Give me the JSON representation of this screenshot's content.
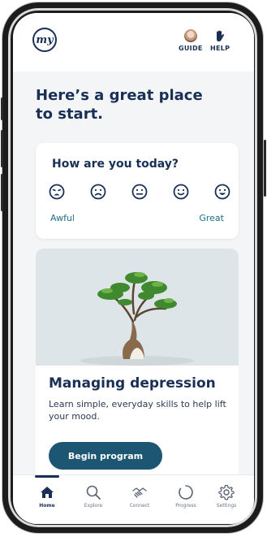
{
  "brand": {
    "logo_text": "my"
  },
  "header": {
    "guide_label": "GUIDE",
    "help_label": "HELP"
  },
  "hero": {
    "title": "Here’s a great place to start."
  },
  "mood": {
    "question": "How are you today?",
    "low_label": "Awful",
    "high_label": "Great",
    "faces": [
      "crying-face-icon",
      "sad-face-icon",
      "neutral-face-icon",
      "happy-face-icon",
      "big-smile-face-icon"
    ]
  },
  "program": {
    "title": "Managing depression",
    "description": "Learn simple, everyday skills to help lift your mood.",
    "button_label": "Begin program"
  },
  "nav": {
    "items": [
      {
        "label": "Home",
        "icon": "home-icon",
        "active": true
      },
      {
        "label": "Explore",
        "icon": "search-icon",
        "active": false
      },
      {
        "label": "Connect",
        "icon": "handshake-icon",
        "active": false
      },
      {
        "label": "Progress",
        "icon": "progress-ring-icon",
        "active": false
      },
      {
        "label": "Settings",
        "icon": "gear-icon",
        "active": false
      }
    ]
  },
  "colors": {
    "navy": "#1a2f55",
    "teal": "#1f6f86",
    "button": "#1c5672"
  }
}
